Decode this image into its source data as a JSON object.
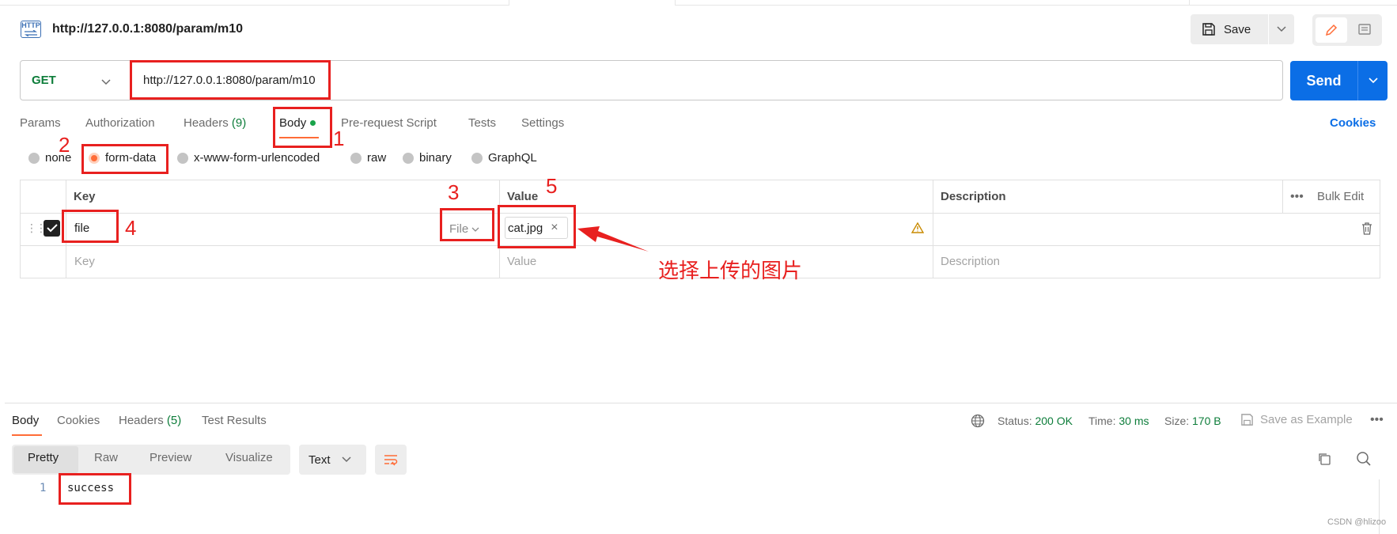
{
  "request": {
    "title": "http://127.0.0.1:8080/param/m10",
    "http_badge": "HTTP",
    "save_label": "Save",
    "method": "GET",
    "url": "http://127.0.0.1:8080/param/m10",
    "send_label": "Send"
  },
  "request_tabs": [
    {
      "label": "Params"
    },
    {
      "label": "Authorization"
    },
    {
      "label": "Headers",
      "count": "(9)"
    },
    {
      "label": "Body",
      "active": true
    },
    {
      "label": "Pre-request Script"
    },
    {
      "label": "Tests"
    },
    {
      "label": "Settings"
    }
  ],
  "cookies_label": "Cookies",
  "body_types": [
    {
      "label": "none"
    },
    {
      "label": "form-data",
      "selected": true
    },
    {
      "label": "x-www-form-urlencoded"
    },
    {
      "label": "raw"
    },
    {
      "label": "binary"
    },
    {
      "label": "GraphQL"
    }
  ],
  "form_table": {
    "headers": {
      "key": "Key",
      "value": "Value",
      "description": "Description"
    },
    "bulk_edit": "Bulk Edit",
    "rows": [
      {
        "key": "file",
        "type": "File",
        "value": "cat.jpg",
        "checked": true
      }
    ],
    "placeholder": {
      "key": "Key",
      "value": "Value",
      "description": "Description"
    }
  },
  "response": {
    "tabs": [
      {
        "label": "Body",
        "active": true
      },
      {
        "label": "Cookies"
      },
      {
        "label": "Headers",
        "count": "(5)"
      },
      {
        "label": "Test Results"
      }
    ],
    "status_label": "Status:",
    "status_value": "200 OK",
    "time_label": "Time:",
    "time_value": "30 ms",
    "size_label": "Size:",
    "size_value": "170 B",
    "save_example": "Save as Example",
    "view_modes": [
      "Pretty",
      "Raw",
      "Preview",
      "Visualize"
    ],
    "format": "Text",
    "line_number": "1",
    "body_text": "success"
  },
  "annotations": {
    "n1": "1",
    "n2": "2",
    "n3": "3",
    "n4": "4",
    "n5": "5",
    "note": "选择上传的图片"
  },
  "watermark": "CSDN @hlizoo",
  "colors": {
    "accent": "#ff6c37",
    "send": "#0b6ee6",
    "annotation": "#e8201f",
    "success": "#0d7d3a"
  }
}
